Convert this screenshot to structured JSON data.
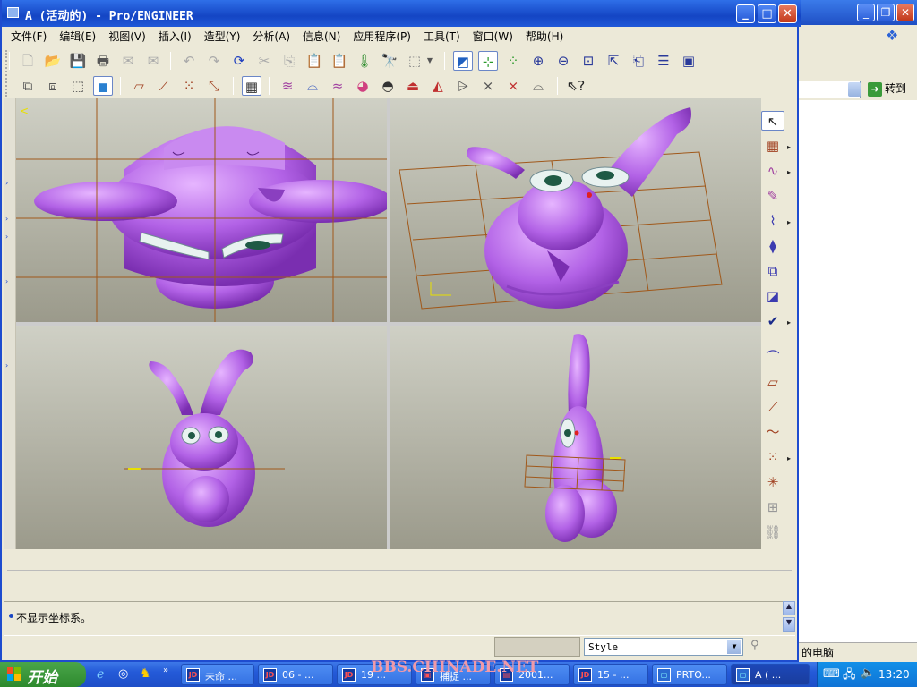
{
  "window": {
    "title": "A (活动的) - Pro/ENGINEER",
    "controls": {
      "minimize": "_",
      "maximize": "□",
      "close": "✕"
    }
  },
  "menu": [
    "文件(F)",
    "编辑(E)",
    "视图(V)",
    "插入(I)",
    "造型(Y)",
    "分析(A)",
    "信息(N)",
    "应用程序(P)",
    "工具(T)",
    "窗口(W)",
    "帮助(H)"
  ],
  "background_window": {
    "go_label": "转到",
    "my_computer": "的电脑"
  },
  "message_area": {
    "text": "不显示坐标系。"
  },
  "status": {
    "filter_value": "Style"
  },
  "taskbar": {
    "start_label": "开始",
    "buttons": [
      {
        "label": "未命 ..."
      },
      {
        "label": "06 - ..."
      },
      {
        "label": "19 ..."
      },
      {
        "label": "捕捉 ..."
      },
      {
        "label": "2001..."
      },
      {
        "label": "15 - ..."
      },
      {
        "label": "PRTO..."
      },
      {
        "label": "A ( ..."
      }
    ],
    "clock": "13:20"
  },
  "watermark": "BBS.CHINADE.NET",
  "colors": {
    "model": "#b468e6",
    "grid": "#a0581a",
    "xp_blue": "#1e4ccf"
  }
}
